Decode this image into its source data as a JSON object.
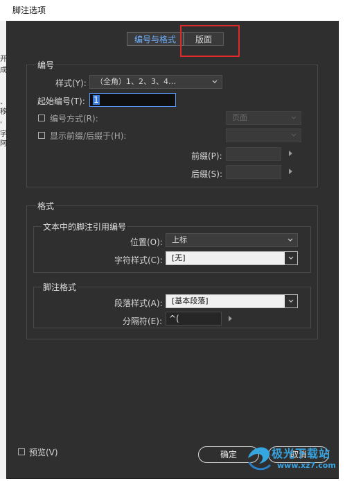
{
  "window": {
    "title": "脚注选项"
  },
  "tabs": [
    {
      "label": "编号与格式",
      "active": true
    },
    {
      "label": "版面",
      "active": false
    }
  ],
  "numbering": {
    "group_label": "编号",
    "style_label": "样式(Y):",
    "style_value": "（全角）1、2、3、4…",
    "start_label": "起始编号(T):",
    "start_value": "1",
    "restart_label": "编号方式(R):",
    "restart_value": "页面",
    "prefix_suffix_label": "显示前缀/后缀于(H):",
    "prefix_suffix_value": "",
    "prefix_label": "前缀(P):",
    "prefix_value": "",
    "suffix_label": "后缀(S):",
    "suffix_value": ""
  },
  "format": {
    "group_label": "格式",
    "ref": {
      "group_label": "文本中的脚注引用编号",
      "position_label": "位置(O):",
      "position_value": "上标",
      "char_style_label": "字符样式(C):",
      "char_style_value": "[无]"
    },
    "footnote": {
      "group_label": "脚注格式",
      "para_style_label": "段落样式(A):",
      "para_style_value": "[基本段落]",
      "separator_label": "分隔符(E):",
      "separator_value": "^("
    }
  },
  "footer": {
    "preview_label": "预览(V)",
    "ok_label": "确定",
    "cancel_label": "取消"
  },
  "background_doc": [
    "开",
    "成",
    "、",
    "移",
    "'",
    "字",
    "阿"
  ],
  "watermark": {
    "text_main": "极光下载站",
    "text_url": "www.xz7.com"
  },
  "colors": {
    "accent": "#6fb0ff",
    "annotation": "#e02a2a",
    "dialog_bg": "#2f2f2f"
  }
}
